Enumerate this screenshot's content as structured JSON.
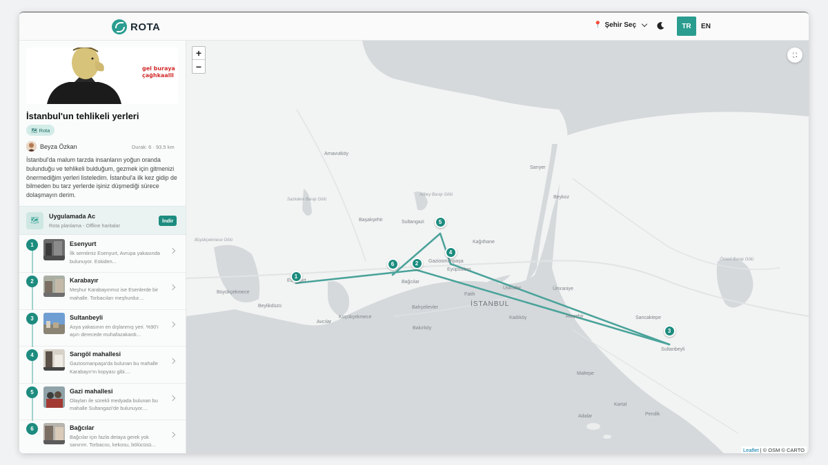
{
  "header": {
    "logo_text": "ROTA",
    "city_select_label": "Şehir Seç",
    "lang_tr": "TR",
    "lang_en": "EN"
  },
  "sidebar": {
    "banner_text": "gel buraya çağhkaalll",
    "route_title": "İstanbul'un tehlikeli yerleri",
    "tag_label": "Rota",
    "author_name": "Beyza Özkan",
    "route_meta": "Durak: 6 · 93.5 km",
    "description": "İstanbul'da malum tarzda insanların yoğun oranda bulunduğu ve tehlikeli bulduğum, gezmek için gitmenizi önermediğim yerleri listeledim. İstanbul'a ilk kez gidip de bilmeden bu tarz yerlerde işiniz düşmediği sürece dolaşmayın derim.",
    "app_card": {
      "title": "Uygulamada Ac",
      "subtitle": "Rota planlama - Offline haritalar",
      "button_label": "İndir"
    },
    "stops": [
      {
        "num": "1",
        "name": "Esenyurt",
        "desc": "İlk semtimiz Esenyurt, Avrupa yakasında bulunuyor. Eskiden..."
      },
      {
        "num": "2",
        "name": "Karabayır",
        "desc": "Meşhur Karabayırımız ise Esenlerde bir mahalle. Torbacıları meşhurdur...."
      },
      {
        "num": "3",
        "name": "Sultanbeyli",
        "desc": "Asya yakasının en dışlanmış yeri. %90'ı aşırı derecede muhafazakardı..."
      },
      {
        "num": "4",
        "name": "Sarıgöl mahallesi",
        "desc": "Gaziosmanpaşa'da bulunan bu mahalle Karabayır'ın kopyası gibi...."
      },
      {
        "num": "5",
        "name": "Gazi mahallesi",
        "desc": "Olayları ile sürekli medyada bulunan bu mahalle Sultangazi'de bulunuyor...."
      },
      {
        "num": "6",
        "name": "Bağcılar",
        "desc": "Bağcılar için fazla detaya gerek yok sanırım. Torbacısı, kekosu, bölücüsü..."
      }
    ]
  },
  "map": {
    "zoom_in": "+",
    "zoom_out": "−",
    "attribution_leaflet": "Leaflet",
    "attribution_rest": " | © OSM © CARTO",
    "labels": {
      "arnavutkoy": "Arnavutköy",
      "sariyer": "Sarıyer",
      "beykoz": "Beykoz",
      "sazlidere": "Sazlıdere Barajı Gölü",
      "alibey": "Alibey Barajı Gölü",
      "basaksehir": "Başakşehir",
      "sultangazi": "Sultangazi",
      "kagithane": "Kağıthane",
      "gaziosmanpasa": "Gaziosmanpaşa",
      "eyupsultan": "Eyüpsultan",
      "buyukcekmece_lake": "Büyükçekmece Gölü",
      "esenyurt": "Esenyurt",
      "bagcilar": "Bağcılar",
      "uskudar": "Üsküdar",
      "umraniye": "Ümraniye",
      "omerli": "Ömerli Barajı Gölü",
      "buyukcekmece": "Büyükçekmece",
      "beylikduzu": "Beylikdüzü",
      "fatih": "Fatih",
      "istanbul": "İSTANBUL",
      "bahcelievler": "Bahçelievler",
      "kucukcekmece": "Küçükçekmece",
      "avcilar": "Avcılar",
      "kadikoy": "Kadıköy",
      "atasehir": "Ataşehir",
      "sancaktepe": "Sancaktepe",
      "sultanbeyli": "Sultanbeyli",
      "bakirkoy": "Bakırköy",
      "maltepe": "Maltepe",
      "kartal": "Kartal",
      "adalar": "Adalar",
      "pendik": "Pendik"
    }
  },
  "colors": {
    "accent": "#2a9d90",
    "accent_dark": "#1d8c7f",
    "route_line": "#4aa39a"
  }
}
